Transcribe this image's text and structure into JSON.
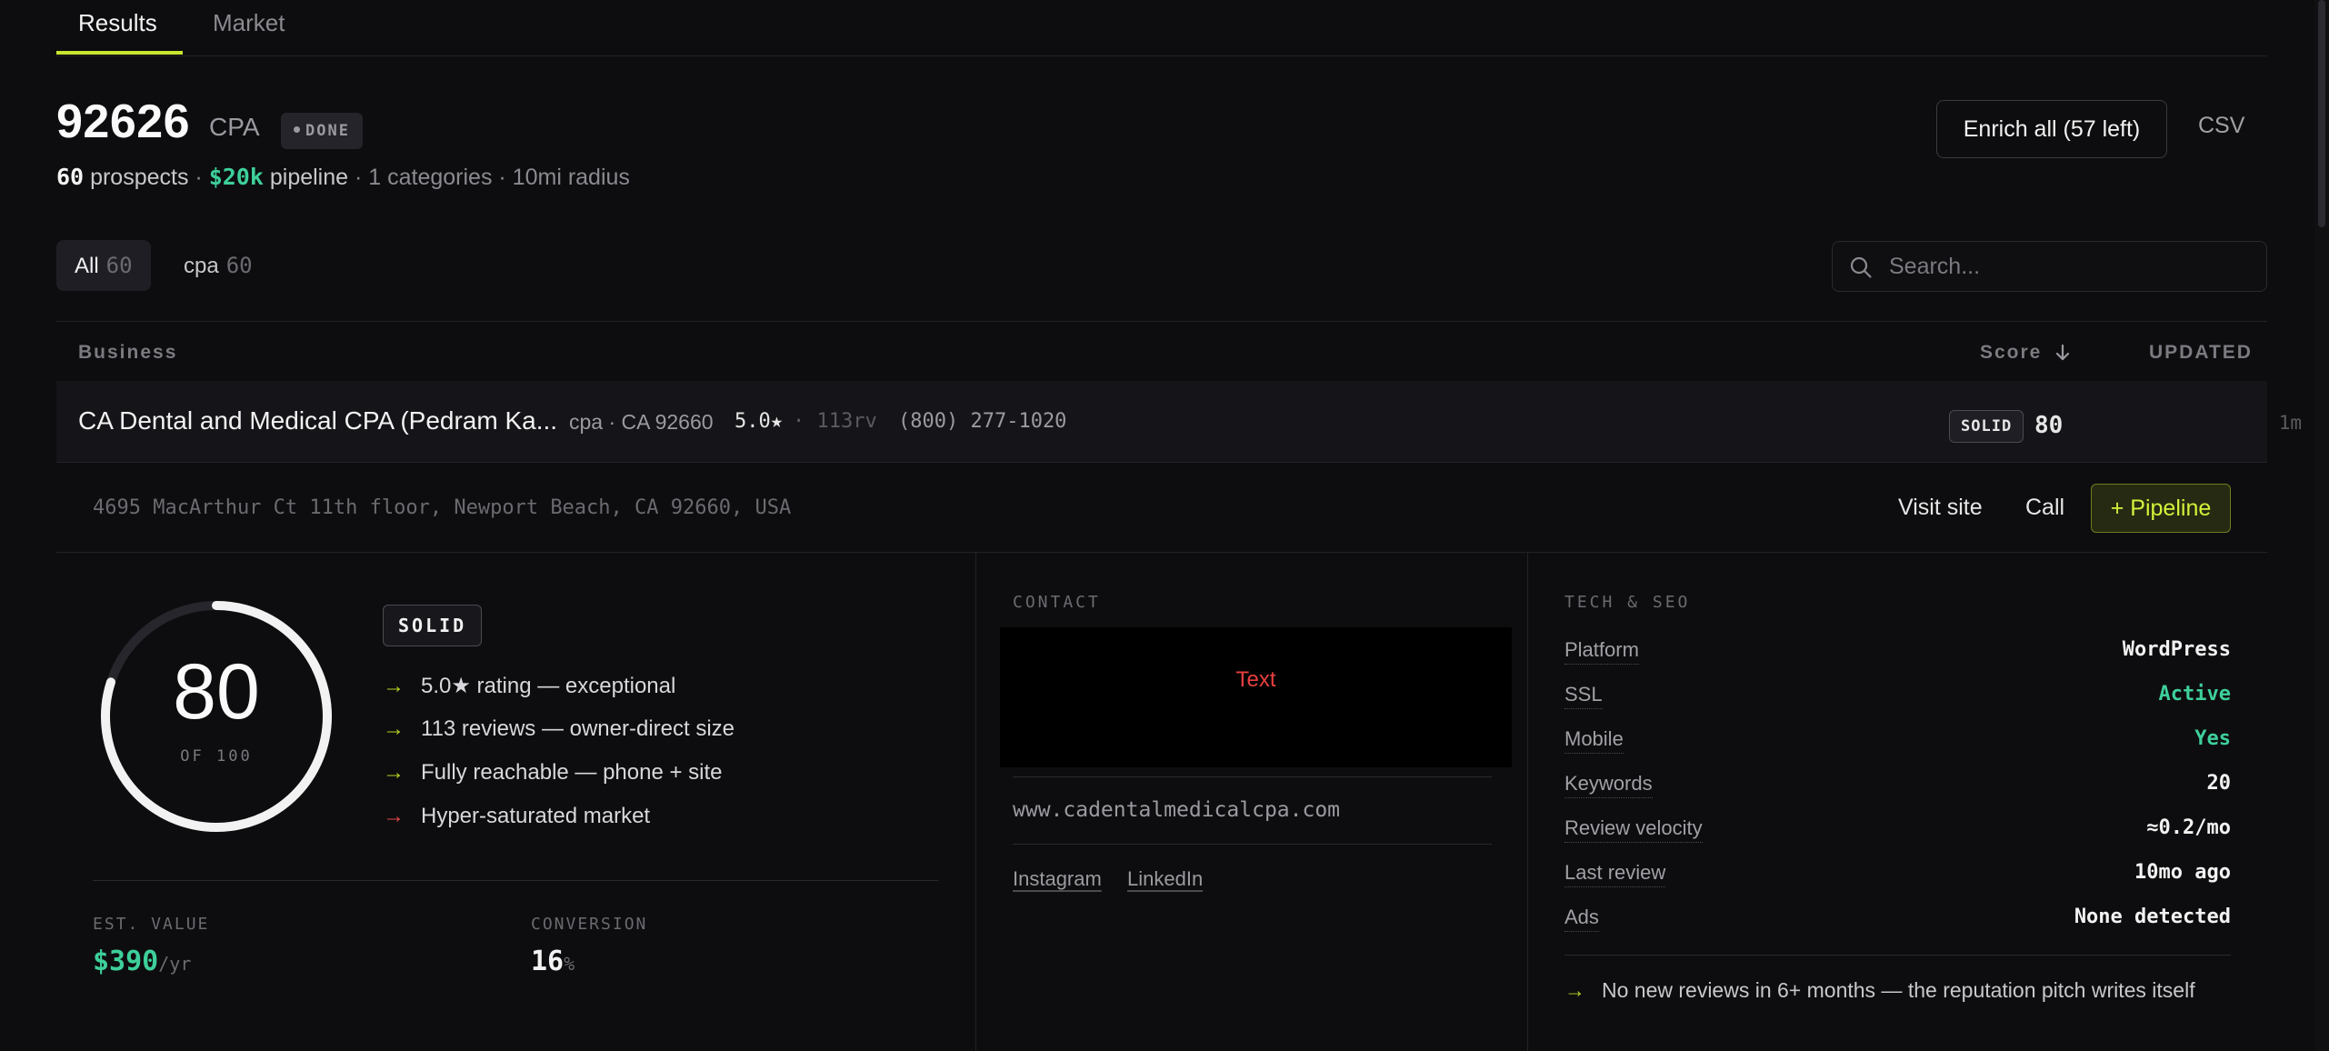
{
  "tabs": [
    {
      "label": "Results",
      "active": true
    },
    {
      "label": "Market",
      "active": false
    }
  ],
  "header": {
    "zip": "92626",
    "category": "CPA",
    "status_badge": "DONE",
    "prospects_count": "60",
    "prospects_label": "prospects",
    "sep1": "·",
    "pipeline_value": "$20k",
    "pipeline_label": "pipeline",
    "rest": "· 1 categories · 10mi radius",
    "enrich_label": "Enrich all (57 left)",
    "csv_label": "CSV"
  },
  "filters": {
    "chips": [
      {
        "label": "All",
        "count": "60"
      },
      {
        "label": "cpa",
        "count": "60"
      }
    ],
    "search_placeholder": "Search..."
  },
  "table": {
    "headers": {
      "business": "Business",
      "score": "Score",
      "updated": "UPDATED"
    },
    "row": {
      "name": "CA Dental and Medical CPA (Pedram Ka...",
      "meta": "cpa · CA 92660",
      "rating": "5.0★",
      "reviews": "· 113rv",
      "phone": "(800) 277-1020",
      "tier": "SOLID",
      "score": "80",
      "updated": "1m"
    }
  },
  "detail": {
    "address": "4695 MacArthur Ct 11th floor, Newport Beach, CA 92660, USA",
    "actions": {
      "visit": "Visit site",
      "call": "Call",
      "pipeline": "+ Pipeline"
    },
    "score": {
      "value": "80",
      "of_label": "OF 100",
      "fraction": 0.8,
      "tier": "SOLID"
    },
    "bullets": [
      {
        "arrow": "→",
        "text": "5.0★ rating — exceptional",
        "tone": "green"
      },
      {
        "arrow": "→",
        "text": "113 reviews — owner-direct size",
        "tone": "green"
      },
      {
        "arrow": "→",
        "text": "Fully reachable — phone + site",
        "tone": "green"
      },
      {
        "arrow": "→",
        "text": "Hyper-saturated market",
        "tone": "red"
      }
    ],
    "est_value": {
      "label": "EST. VALUE",
      "value": "$390",
      "unit": "/yr"
    },
    "conversion": {
      "label": "CONVERSION",
      "value": "16",
      "unit": "%"
    },
    "contact": {
      "label": "CONTACT",
      "box_text": "Text",
      "website": "www.cadentalmedicalcpa.com",
      "socials": [
        "Instagram",
        "LinkedIn"
      ]
    },
    "tech": {
      "label": "TECH & SEO",
      "rows": [
        {
          "key": "Platform",
          "value": "WordPress",
          "tone": "default"
        },
        {
          "key": "SSL",
          "value": "Active",
          "tone": "green"
        },
        {
          "key": "Mobile",
          "value": "Yes",
          "tone": "green"
        },
        {
          "key": "Keywords",
          "value": "20",
          "tone": "default"
        },
        {
          "key": "Review velocity",
          "value": "≈0.2/mo",
          "tone": "default"
        },
        {
          "key": "Last review",
          "value": "10mo ago",
          "tone": "default"
        },
        {
          "key": "Ads",
          "value": "None detected",
          "tone": "default"
        }
      ],
      "tip_arrow": "→",
      "tip": "No new reviews in 6+ months — the reputation pitch writes itself"
    }
  },
  "colors": {
    "accent_lime": "#c8e62e",
    "green": "#3ecf9a",
    "red": "#e04848",
    "background": "#0d0d0f"
  },
  "icons": {
    "search": "search-icon",
    "sort": "arrow-down-icon",
    "dot": "status-dot-icon",
    "arrow": "arrow-right-icon"
  }
}
